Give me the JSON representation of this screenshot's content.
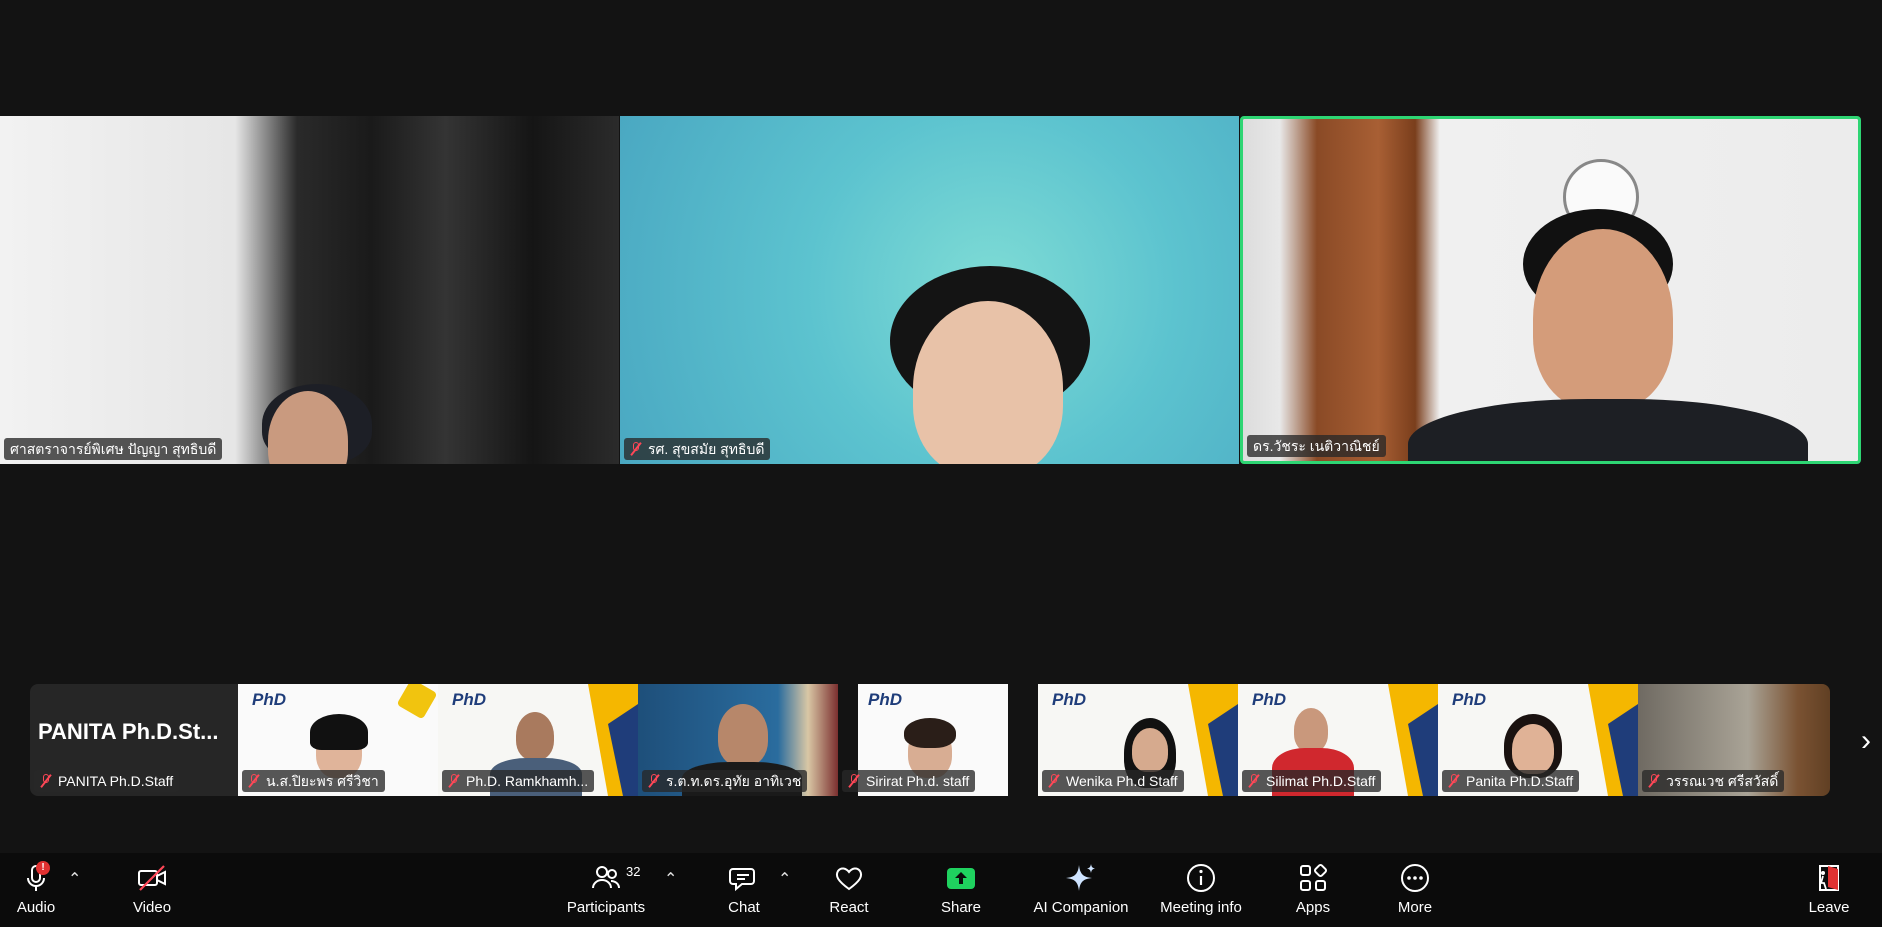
{
  "main_tiles": [
    {
      "name": "ศาสตราจารย์พิเศษ ปัญญา สุทธิบดี",
      "muted": false,
      "active": false
    },
    {
      "name": "รศ. สุขสมัย สุทธิบดี",
      "muted": true,
      "active": false
    },
    {
      "name": "ดร.วัชระ เนติวาณิชย์",
      "muted": false,
      "active": true
    }
  ],
  "filmstrip": {
    "tiles": [
      {
        "name": "PANITA Ph.D.Staff",
        "display_name": "PANITA  Ph.D.St...",
        "video": false
      },
      {
        "name": "น.ส.ปิยะพร ศรีวิชา",
        "video": true
      },
      {
        "name": "Ph.D. Ramkhamh...",
        "video": true
      },
      {
        "name": "ร.ต.ท.ดร.อุทัย อาทิเวช",
        "video": true
      },
      {
        "name": "Sirirat Ph.d. staff",
        "video": true
      },
      {
        "name": "Wenika Ph.d Staff",
        "video": true
      },
      {
        "name": "Silimat Ph.D.Staff",
        "video": true
      },
      {
        "name": "Panita Ph.D.Staff",
        "video": true
      },
      {
        "name": "วรรณเวช  ศรีสวัสดิ์",
        "video": true
      }
    ],
    "logo_text": "PhD",
    "next_icon": "chevron-right-icon"
  },
  "toolbar": {
    "audio": {
      "label": "Audio",
      "badge": "!"
    },
    "video": {
      "label": "Video"
    },
    "participants": {
      "label": "Participants",
      "count": "32"
    },
    "chat": {
      "label": "Chat"
    },
    "react": {
      "label": "React"
    },
    "share": {
      "label": "Share"
    },
    "ai_companion": {
      "label": "AI Companion"
    },
    "meeting_info": {
      "label": "Meeting info"
    },
    "apps": {
      "label": "Apps"
    },
    "more": {
      "label": "More"
    },
    "leave": {
      "label": "Leave"
    }
  },
  "colors": {
    "background": "#131313",
    "active_speaker_border": "#2ed573",
    "share_green": "#1fd25f",
    "muted_red": "#ff4757"
  }
}
